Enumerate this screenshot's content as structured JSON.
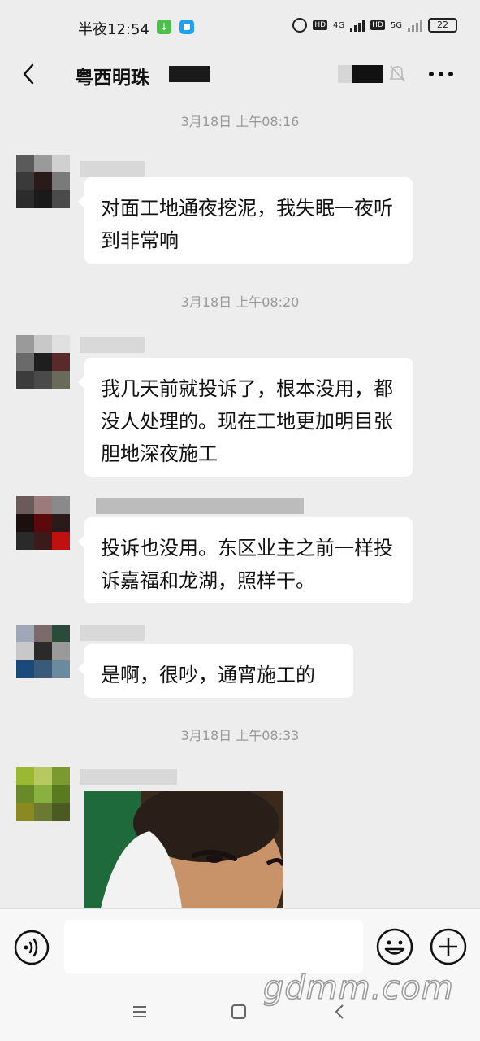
{
  "status_bar": {
    "time": "半夜12:54",
    "network_4g": "4G",
    "network_5g": "5G",
    "hd": "HD",
    "battery": "22"
  },
  "header": {
    "title": "粤西明珠"
  },
  "messages": [
    {
      "timestamp": "3月18日 上午08:16"
    },
    {
      "text": "对面工地通夜挖泥，我失眠一夜听到非常响"
    },
    {
      "timestamp": "3月18日 上午08:20"
    },
    {
      "text": "我几天前就投诉了，根本没用，都没人处理的。现在工地更加明目张胆地深夜施工"
    },
    {
      "text": "投诉也没用。东区业主之前一样投诉嘉福和龙湖，照样干。"
    },
    {
      "text": "是啊，很吵，通宵施工的"
    },
    {
      "timestamp": "3月18日 上午08:33"
    }
  ],
  "input": {
    "placeholder": ""
  },
  "watermark": "gdmm.com",
  "colors": {
    "background": "#ededed",
    "bubble": "#ffffff",
    "timestamp": "#999999"
  }
}
